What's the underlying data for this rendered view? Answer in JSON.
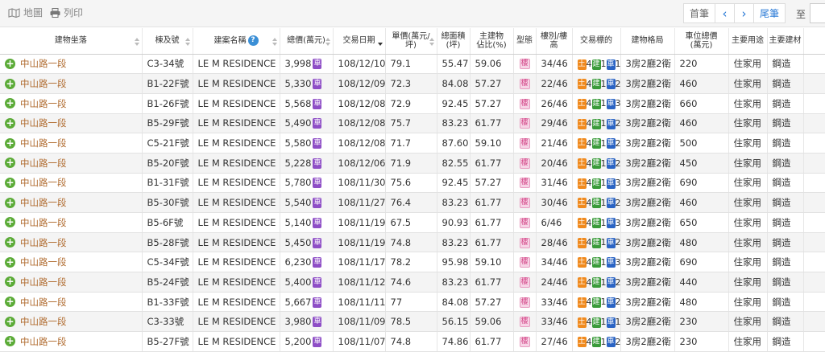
{
  "toolbar": {
    "map_label": "地圖",
    "print_label": "列印",
    "first_label": "首筆",
    "prev_icon": "‹",
    "next_icon": "›",
    "last_label": "尾筆",
    "to_label": "至"
  },
  "columns": {
    "address": "建物坐落",
    "unit": "棟及號",
    "project": "建案名稱",
    "help": "?",
    "total_price": "總價(萬元)",
    "date": "交易日期",
    "unit_price": "單價(萬元/坪)",
    "area_1": "總面積",
    "area_2": "(坪)",
    "main_ratio_1": "主建物",
    "main_ratio_2": "佔比(%)",
    "type": "型態",
    "floor": "樓別/樓高",
    "tx_target": "交易標的",
    "layout": "建物格局",
    "parking_1": "車位總價",
    "parking_2": "(萬元)",
    "usage": "主要用途",
    "material": "主要建材"
  },
  "badges": {
    "price": "車",
    "type": "樓",
    "land": "土",
    "bld": "建",
    "park": "車"
  },
  "rows": [
    {
      "address": "中山路一段",
      "unit": "C3-34號",
      "project": "LE M RESIDENCE",
      "total": "3,998",
      "date": "108/12/10",
      "unit_price": "79.1",
      "area": "55.47",
      "ratio": "59.06",
      "floor": "34/46",
      "land": "4",
      "bld": "1",
      "park": "1",
      "layout": "3房2廳2衛",
      "parking": "220",
      "usage": "住家用",
      "material": "鋼造"
    },
    {
      "address": "中山路一段",
      "unit": "B1-22F號",
      "project": "LE M RESIDENCE",
      "total": "5,330",
      "date": "108/12/09",
      "unit_price": "72.3",
      "area": "84.08",
      "ratio": "57.27",
      "floor": "22/46",
      "land": "4",
      "bld": "1",
      "park": "2",
      "layout": "3房2廳2衛",
      "parking": "460",
      "usage": "住家用",
      "material": "鋼造"
    },
    {
      "address": "中山路一段",
      "unit": "B1-26F號",
      "project": "LE M RESIDENCE",
      "total": "5,568",
      "date": "108/12/08",
      "unit_price": "72.9",
      "area": "92.45",
      "ratio": "57.27",
      "floor": "26/46",
      "land": "4",
      "bld": "1",
      "park": "3",
      "layout": "3房2廳2衛",
      "parking": "660",
      "usage": "住家用",
      "material": "鋼造"
    },
    {
      "address": "中山路一段",
      "unit": "B5-29F號",
      "project": "LE M RESIDENCE",
      "total": "5,490",
      "date": "108/12/08",
      "unit_price": "75.7",
      "area": "83.23",
      "ratio": "61.77",
      "floor": "29/46",
      "land": "4",
      "bld": "1",
      "park": "2",
      "layout": "3房2廳2衛",
      "parking": "460",
      "usage": "住家用",
      "material": "鋼造"
    },
    {
      "address": "中山路一段",
      "unit": "C5-21F號",
      "project": "LE M RESIDENCE",
      "total": "5,580",
      "date": "108/12/08",
      "unit_price": "71.7",
      "area": "87.60",
      "ratio": "59.10",
      "floor": "21/46",
      "land": "4",
      "bld": "1",
      "park": "2",
      "layout": "3房2廳2衛",
      "parking": "500",
      "usage": "住家用",
      "material": "鋼造"
    },
    {
      "address": "中山路一段",
      "unit": "B5-20F號",
      "project": "LE M RESIDENCE",
      "total": "5,228",
      "date": "108/12/06",
      "unit_price": "71.9",
      "area": "82.55",
      "ratio": "61.77",
      "floor": "20/46",
      "land": "4",
      "bld": "1",
      "park": "2",
      "layout": "3房2廳2衛",
      "parking": "450",
      "usage": "住家用",
      "material": "鋼造"
    },
    {
      "address": "中山路一段",
      "unit": "B1-31F號",
      "project": "LE M RESIDENCE",
      "total": "5,780",
      "date": "108/11/30",
      "unit_price": "75.6",
      "area": "92.45",
      "ratio": "57.27",
      "floor": "31/46",
      "land": "4",
      "bld": "1",
      "park": "3",
      "layout": "3房2廳2衛",
      "parking": "690",
      "usage": "住家用",
      "material": "鋼造"
    },
    {
      "address": "中山路一段",
      "unit": "B5-30F號",
      "project": "LE M RESIDENCE",
      "total": "5,540",
      "date": "108/11/27",
      "unit_price": "76.4",
      "area": "83.23",
      "ratio": "61.77",
      "floor": "30/46",
      "land": "4",
      "bld": "1",
      "park": "2",
      "layout": "3房2廳2衛",
      "parking": "460",
      "usage": "住家用",
      "material": "鋼造"
    },
    {
      "address": "中山路一段",
      "unit": "B5-6F號",
      "project": "LE M RESIDENCE",
      "total": "5,140",
      "date": "108/11/19",
      "unit_price": "67.5",
      "area": "90.93",
      "ratio": "61.77",
      "floor": "6/46",
      "land": "4",
      "bld": "1",
      "park": "3",
      "layout": "3房2廳2衛",
      "parking": "650",
      "usage": "住家用",
      "material": "鋼造"
    },
    {
      "address": "中山路一段",
      "unit": "B5-28F號",
      "project": "LE M RESIDENCE",
      "total": "5,450",
      "date": "108/11/19",
      "unit_price": "74.8",
      "area": "83.23",
      "ratio": "61.77",
      "floor": "28/46",
      "land": "4",
      "bld": "1",
      "park": "2",
      "layout": "3房2廳2衛",
      "parking": "480",
      "usage": "住家用",
      "material": "鋼造"
    },
    {
      "address": "中山路一段",
      "unit": "C5-34F號",
      "project": "LE M RESIDENCE",
      "total": "6,230",
      "date": "108/11/17",
      "unit_price": "78.2",
      "area": "95.98",
      "ratio": "59.10",
      "floor": "34/46",
      "land": "4",
      "bld": "1",
      "park": "3",
      "layout": "3房2廳2衛",
      "parking": "690",
      "usage": "住家用",
      "material": "鋼造"
    },
    {
      "address": "中山路一段",
      "unit": "B5-24F號",
      "project": "LE M RESIDENCE",
      "total": "5,400",
      "date": "108/11/12",
      "unit_price": "74.6",
      "area": "83.23",
      "ratio": "61.77",
      "floor": "24/46",
      "land": "4",
      "bld": "1",
      "park": "2",
      "layout": "3房2廳2衛",
      "parking": "440",
      "usage": "住家用",
      "material": "鋼造"
    },
    {
      "address": "中山路一段",
      "unit": "B1-33F號",
      "project": "LE M RESIDENCE",
      "total": "5,667",
      "date": "108/11/11",
      "unit_price": "77",
      "area": "84.08",
      "ratio": "57.27",
      "floor": "33/46",
      "land": "4",
      "bld": "1",
      "park": "2",
      "layout": "3房2廳2衛",
      "parking": "480",
      "usage": "住家用",
      "material": "鋼造"
    },
    {
      "address": "中山路一段",
      "unit": "C3-33號",
      "project": "LE M RESIDENCE",
      "total": "3,980",
      "date": "108/11/09",
      "unit_price": "78.5",
      "area": "56.15",
      "ratio": "59.06",
      "floor": "33/46",
      "land": "4",
      "bld": "1",
      "park": "1",
      "layout": "3房2廳2衛",
      "parking": "230",
      "usage": "住家用",
      "material": "鋼造"
    },
    {
      "address": "中山路一段",
      "unit": "B5-27F號",
      "project": "LE M RESIDENCE",
      "total": "5,200",
      "date": "108/11/07",
      "unit_price": "74.8",
      "area": "74.86",
      "ratio": "61.77",
      "floor": "27/46",
      "land": "4",
      "bld": "1",
      "park": "2",
      "layout": "3房2廳2衛",
      "parking": "230",
      "usage": "住家用",
      "material": "鋼造"
    }
  ]
}
